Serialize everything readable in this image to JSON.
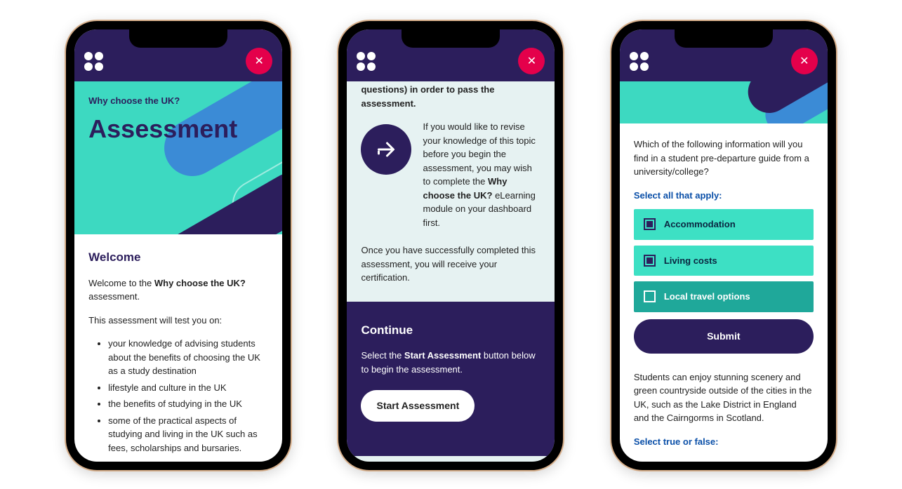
{
  "header": {
    "close_glyph": "✕"
  },
  "screen1": {
    "subtitle": "Why choose the UK?",
    "title": "Assessment",
    "welcome_heading": "Welcome",
    "welcome_prefix": "Welcome to the ",
    "welcome_bold": "Why choose the UK?",
    "welcome_suffix": " assessment.",
    "test_intro": "This assessment will test you on:",
    "bullets": [
      "your knowledge of advising students about the benefits of choosing the UK as a study destination",
      "lifestyle and culture in the UK",
      "the benefits of studying in the UK",
      "some of the practical aspects of studying and living in the UK such as fees, scholarships and bursaries."
    ]
  },
  "screen2": {
    "cutoff_text": "questions) in order to pass the assessment.",
    "revise_prefix": "If you would like to revise your knowledge of this topic before you begin the assessment, you may wish to complete the ",
    "revise_bold": "Why choose the UK?",
    "revise_suffix": " eLearning module on your dashboard first.",
    "cert_text": "Once you have successfully completed this assessment, you will receive your certification.",
    "continue_heading": "Continue",
    "continue_prefix": "Select the ",
    "continue_bold": "Start Assessment",
    "continue_suffix": " button below to begin the assessment.",
    "start_label": "Start Assessment"
  },
  "screen3": {
    "question": "Which of the following information will you find in a student pre-departure guide from a university/college?",
    "instruction1": "Select all that apply:",
    "options": [
      {
        "label": "Accommodation",
        "selected": true
      },
      {
        "label": "Living costs",
        "selected": true
      },
      {
        "label": "Local travel options",
        "selected": false
      }
    ],
    "submit_label": "Submit",
    "statement": "Students can enjoy stunning scenery and green countryside outside of the cities in the UK, such as the Lake District in England and the Cairngorms in Scotland.",
    "instruction2": "Select true or false:"
  }
}
